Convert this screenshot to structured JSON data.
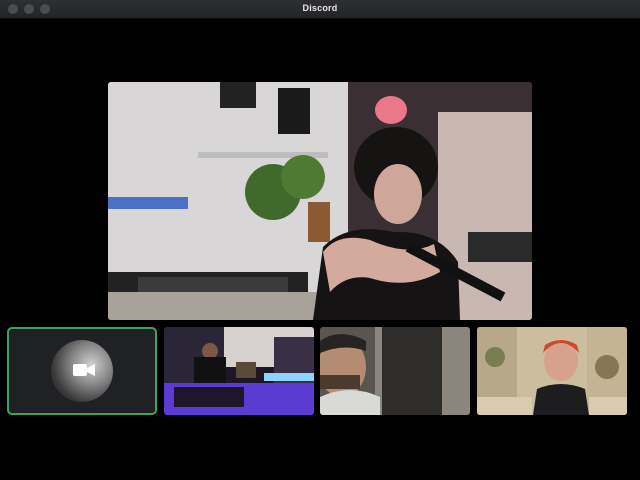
{
  "window": {
    "title": "Discord"
  },
  "call": {
    "main_stream": {
      "icon": "video-stream"
    },
    "self_tile": {
      "icon": "video-camera-icon",
      "speaking_color": "#3ba55c"
    },
    "participants": [
      {
        "icon": "video-stream"
      },
      {
        "icon": "video-stream"
      },
      {
        "icon": "video-stream"
      }
    ]
  }
}
